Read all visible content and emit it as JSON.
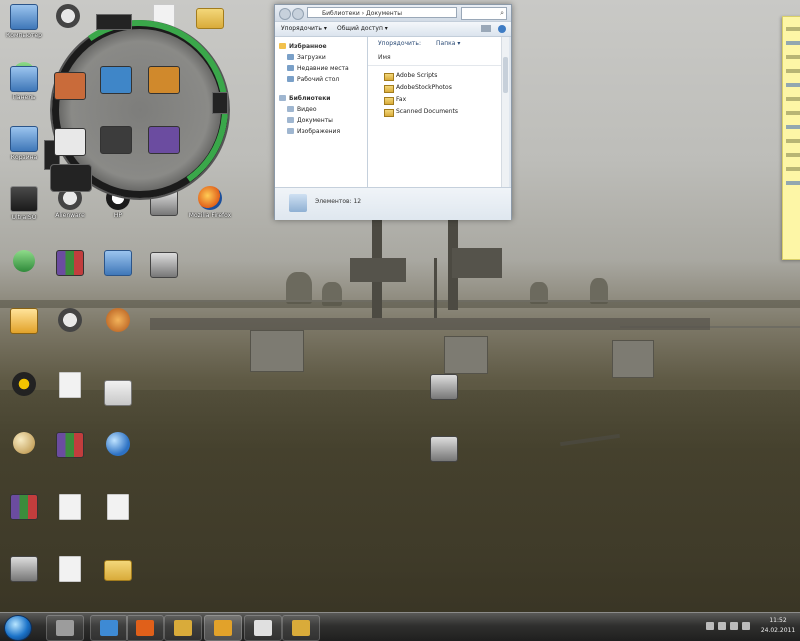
{
  "desktop_icons": [
    {
      "id": "computer",
      "label": "Компьютер",
      "glyph": "g-pc",
      "icon": "computer-icon"
    },
    {
      "id": "skull-app",
      "label": "",
      "glyph": "g-skull",
      "icon": "skull-app-icon"
    },
    {
      "id": "doc-1",
      "label": "",
      "glyph": "g-doc",
      "icon": "document-icon"
    },
    {
      "id": "folder-1",
      "label": "",
      "glyph": "g-folder",
      "icon": "folder-icon"
    },
    {
      "id": "network",
      "label": "Сеть",
      "glyph": "g-net",
      "icon": "network-icon"
    },
    {
      "id": "control-panel",
      "label": "Панель",
      "glyph": "g-pc",
      "icon": "control-panel-icon"
    },
    {
      "id": "recycle",
      "label": "Корзина",
      "glyph": "g-pc",
      "icon": "recycle-bin-icon"
    },
    {
      "id": "ultraiso",
      "label": "UltraISO",
      "glyph": "g-app",
      "icon": "disc-icon"
    },
    {
      "id": "alien",
      "label": "Alienware",
      "glyph": "g-skull",
      "icon": "alien-icon"
    },
    {
      "id": "hp",
      "label": "HP",
      "glyph": "g-hp",
      "icon": "hp-icon"
    },
    {
      "id": "media-1",
      "label": "",
      "glyph": "g-media",
      "icon": "media-icon"
    },
    {
      "id": "firefox",
      "label": "Mozilla Firefox",
      "glyph": "g-fox",
      "icon": "firefox-icon"
    },
    {
      "id": "torrent",
      "label": "",
      "glyph": "g-net",
      "icon": "torrent-icon"
    },
    {
      "id": "winrar",
      "label": "",
      "glyph": "g-rar",
      "icon": "winrar-icon"
    },
    {
      "id": "computer-2",
      "label": "",
      "glyph": "g-pc",
      "icon": "monitor-icon"
    },
    {
      "id": "screen-1",
      "label": "",
      "glyph": "g-media",
      "icon": "screen-icon"
    },
    {
      "id": "wmp",
      "label": "",
      "glyph": "g-wmp",
      "icon": "player-icon"
    },
    {
      "id": "stalker-1",
      "label": "",
      "glyph": "g-skull",
      "icon": "stalker-icon"
    },
    {
      "id": "game-1",
      "label": "",
      "glyph": "g-orange",
      "icon": "game-icon"
    },
    {
      "id": "stalker-2",
      "label": "",
      "glyph": "g-stalker",
      "icon": "stalker-game-icon"
    },
    {
      "id": "doc-2",
      "label": "",
      "glyph": "g-doc",
      "icon": "document-icon"
    },
    {
      "id": "bbc",
      "label": "",
      "glyph": "g-slides",
      "icon": "slides-icon"
    },
    {
      "id": "ball",
      "label": "",
      "glyph": "g-ball",
      "icon": "ball-icon"
    },
    {
      "id": "winrar-2",
      "label": "",
      "glyph": "g-rar",
      "icon": "archive-icon"
    },
    {
      "id": "globe",
      "label": "",
      "glyph": "g-globe",
      "icon": "globe-icon"
    },
    {
      "id": "winrar-3",
      "label": "",
      "glyph": "g-rar",
      "icon": "archive-icon"
    },
    {
      "id": "doc-3",
      "label": "",
      "glyph": "g-doc",
      "icon": "document-icon"
    },
    {
      "id": "doc-4",
      "label": "",
      "glyph": "g-doc",
      "icon": "document-icon"
    },
    {
      "id": "media-2",
      "label": "",
      "glyph": "g-media",
      "icon": "media-icon"
    },
    {
      "id": "doc-5",
      "label": "",
      "glyph": "g-doc",
      "icon": "document-icon"
    },
    {
      "id": "folder-2",
      "label": "",
      "glyph": "g-folder",
      "icon": "folder-icon"
    },
    {
      "id": "screen-2",
      "label": "",
      "glyph": "g-media",
      "icon": "screen-icon"
    },
    {
      "id": "screen-3",
      "label": "",
      "glyph": "g-media",
      "icon": "screen-icon"
    }
  ],
  "gadget": {
    "slots": [
      {
        "id": "slot-1",
        "icon": "image-icon",
        "color": "#c96b3a"
      },
      {
        "id": "slot-2",
        "icon": "globe-icon",
        "color": "#3f86c8"
      },
      {
        "id": "slot-3",
        "icon": "paint-icon",
        "color": "#d0892c"
      },
      {
        "id": "slot-4",
        "icon": "document-icon",
        "color": "#e8e8e8"
      },
      {
        "id": "slot-5",
        "icon": "nvidia-icon",
        "color": "#3c3c3c"
      },
      {
        "id": "slot-6",
        "icon": "archive-icon",
        "color": "#6b4ca0"
      }
    ],
    "accent": "#3aa74a"
  },
  "explorer": {
    "address": "Библиотеки › Документы",
    "toolbar": {
      "organize": "Упорядочить ▾",
      "share": "Общий доступ ▾"
    },
    "nav": {
      "favorites_header": "Избранное",
      "favorites": [
        "Загрузки",
        "Недавние места",
        "Рабочий стол"
      ],
      "libraries_header": "Библиотеки",
      "libraries": [
        "Видео",
        "Документы",
        "Изображения"
      ]
    },
    "sort": {
      "label": "Упорядочить:",
      "value": "Папка ▾"
    },
    "column_header": "Имя",
    "files": [
      "Adobe Scripts",
      "AdobeStockPhotos",
      "Fax",
      "Scanned Documents"
    ],
    "details": "Элементов: 12"
  },
  "sticky_note": {
    "color": "#fdf6a6"
  },
  "taskbar": {
    "buttons": [
      {
        "id": "media-player",
        "icon": "media-player-icon",
        "color": "#9c9c9c"
      },
      {
        "id": "ie",
        "icon": "ie-icon",
        "color": "#3e8ad4"
      },
      {
        "id": "firefox",
        "icon": "firefox-icon",
        "color": "#e0601a"
      },
      {
        "id": "explorer",
        "icon": "explorer-icon",
        "color": "#d9ab3a"
      },
      {
        "id": "paint",
        "icon": "paint-icon",
        "color": "#e2a22a"
      },
      {
        "id": "bbc",
        "icon": "slides-icon",
        "color": "#e0e0e0"
      },
      {
        "id": "folder",
        "icon": "folder-icon",
        "color": "#d9ab3a"
      }
    ],
    "clock": {
      "time": "11:52",
      "date": "24.02.2011"
    }
  }
}
